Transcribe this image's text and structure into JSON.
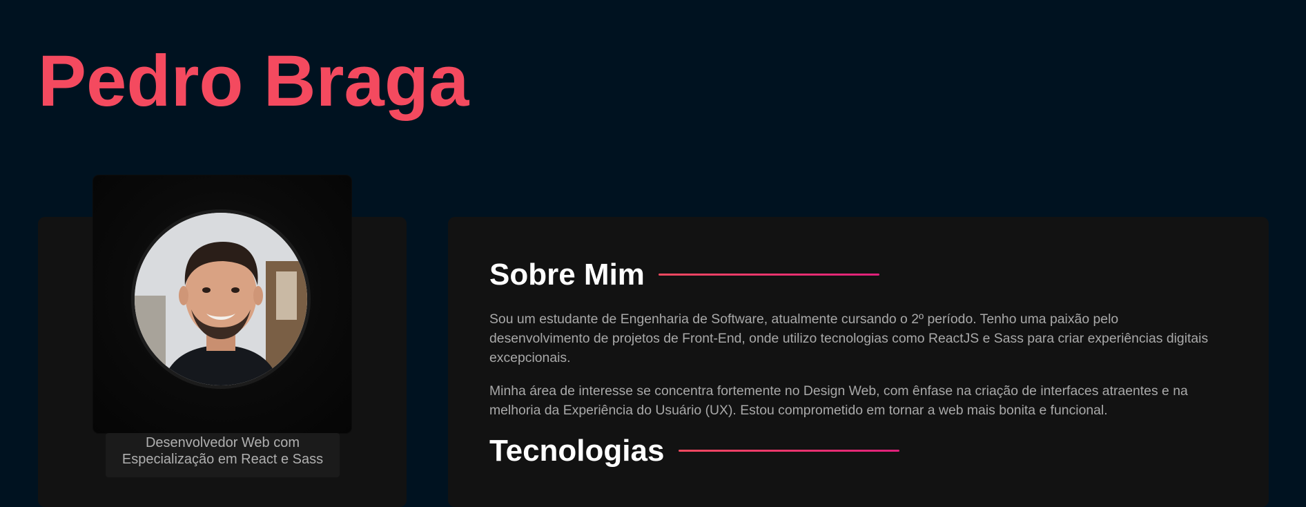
{
  "header": {
    "name": "Pedro Braga"
  },
  "profile": {
    "role_line1": "Desenvolvedor Web com",
    "role_line2": "Especialização em React e Sass"
  },
  "about": {
    "heading": "Sobre Mim",
    "paragraph1": "Sou um estudante de Engenharia de Software, atualmente cursando o 2º período. Tenho uma paixão pelo desenvolvimento de projetos de Front-End, onde utilizo tecnologias como ReactJS e Sass para criar experiências digitais excepcionais.",
    "paragraph2": "Minha área de interesse se concentra fortemente no Design Web, com ênfase na criação de interfaces atraentes e na melhoria da Experiência do Usuário (UX). Estou comprometido em tornar a web mais bonita e funcional."
  },
  "technologies": {
    "heading": "Tecnologias"
  },
  "colors": {
    "page_background": "#001220",
    "accent": "#f44a5f",
    "card_background": "#121212",
    "heading_text": "#ffffff",
    "body_text": "#a9a9a9"
  }
}
